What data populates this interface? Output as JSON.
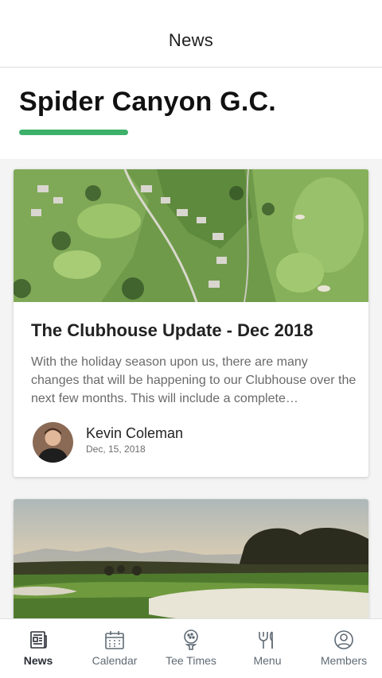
{
  "topbar": {
    "title": "News"
  },
  "header": {
    "club_name": "Spider Canyon G.C."
  },
  "theme": {
    "accent": "#3db06a"
  },
  "posts": [
    {
      "title": "The Clubhouse Update - Dec 2018",
      "excerpt": "With the holiday season upon us, there are many changes that will be happening to our Clubhouse over the next few months. This will include a complete…",
      "author": "Kevin Coleman",
      "date": "Dec, 15, 2018"
    }
  ],
  "tabs": [
    {
      "label": "News",
      "icon": "newspaper-icon",
      "active": true
    },
    {
      "label": "Calendar",
      "icon": "calendar-icon",
      "active": false
    },
    {
      "label": "Tee Times",
      "icon": "golf-ball-tee-icon",
      "active": false
    },
    {
      "label": "Menu",
      "icon": "cutlery-icon",
      "active": false
    },
    {
      "label": "Members",
      "icon": "user-circle-icon",
      "active": false
    }
  ]
}
